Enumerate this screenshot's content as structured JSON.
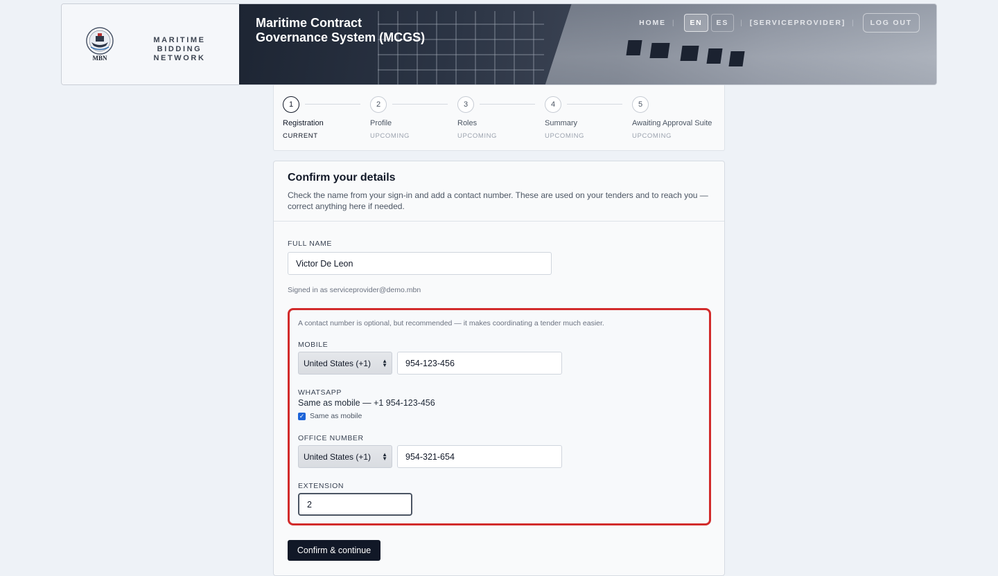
{
  "brand": {
    "logo_text": "MBN",
    "name_line1": "MARITIME BIDDING",
    "name_line2": "NETWORK"
  },
  "header": {
    "title_line1": "Maritime Contract",
    "title_line2": "Governance System (MCGS)",
    "nav": {
      "home": "HOME",
      "lang_en": "EN",
      "lang_es": "ES",
      "role": "[SERVICEPROVIDER]",
      "logout": "LOG OUT"
    },
    "active_lang": "EN"
  },
  "stepper": {
    "steps": [
      {
        "number": "1",
        "label": "Registration",
        "status": "CURRENT"
      },
      {
        "number": "2",
        "label": "Profile",
        "status": "UPCOMING"
      },
      {
        "number": "3",
        "label": "Roles",
        "status": "UPCOMING"
      },
      {
        "number": "4",
        "label": "Summary",
        "status": "UPCOMING"
      },
      {
        "number": "5",
        "label": "Awaiting Approval Suite",
        "status": "UPCOMING"
      }
    ]
  },
  "card": {
    "title": "Confirm your details",
    "description": "Check the name from your sign-in and add a contact number. These are used on your tenders and to reach you — correct anything here if needed.",
    "full_name_label": "FULL NAME",
    "full_name_value": "Victor De Leon",
    "signed_in": "Signed in as serviceprovider@demo.mbn",
    "contact": {
      "note": "A contact number is optional, but recommended — it makes coordinating a tender much easier.",
      "mobile_label": "MOBILE",
      "mobile_country": "United States (+1)",
      "mobile_number": "954-123-456",
      "whatsapp_label": "WHATSAPP",
      "whatsapp_text": "Same as mobile — +1 954-123-456",
      "same_as_mobile_label": "Same as mobile",
      "same_as_mobile_checked": true,
      "office_label": "OFFICE NUMBER",
      "office_country": "United States (+1)",
      "office_number": "954-321-654",
      "extension_label": "EXTENSION",
      "extension_value": "2"
    },
    "confirm_button": "Confirm & continue"
  },
  "colors": {
    "accent_dark": "#111827",
    "highlight_border": "#d22b2b",
    "checkbox": "#1d64d8",
    "page_bg": "#eef2f7"
  }
}
